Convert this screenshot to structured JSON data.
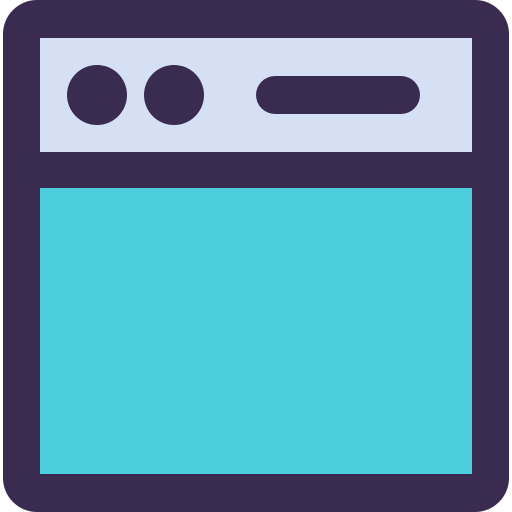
{
  "icon": {
    "name": "browser-window-icon"
  },
  "colors": {
    "outline": "#3a2b50",
    "titlebar": "#d6e0f5",
    "content": "#4bcfdf",
    "background": "#ffffff"
  }
}
